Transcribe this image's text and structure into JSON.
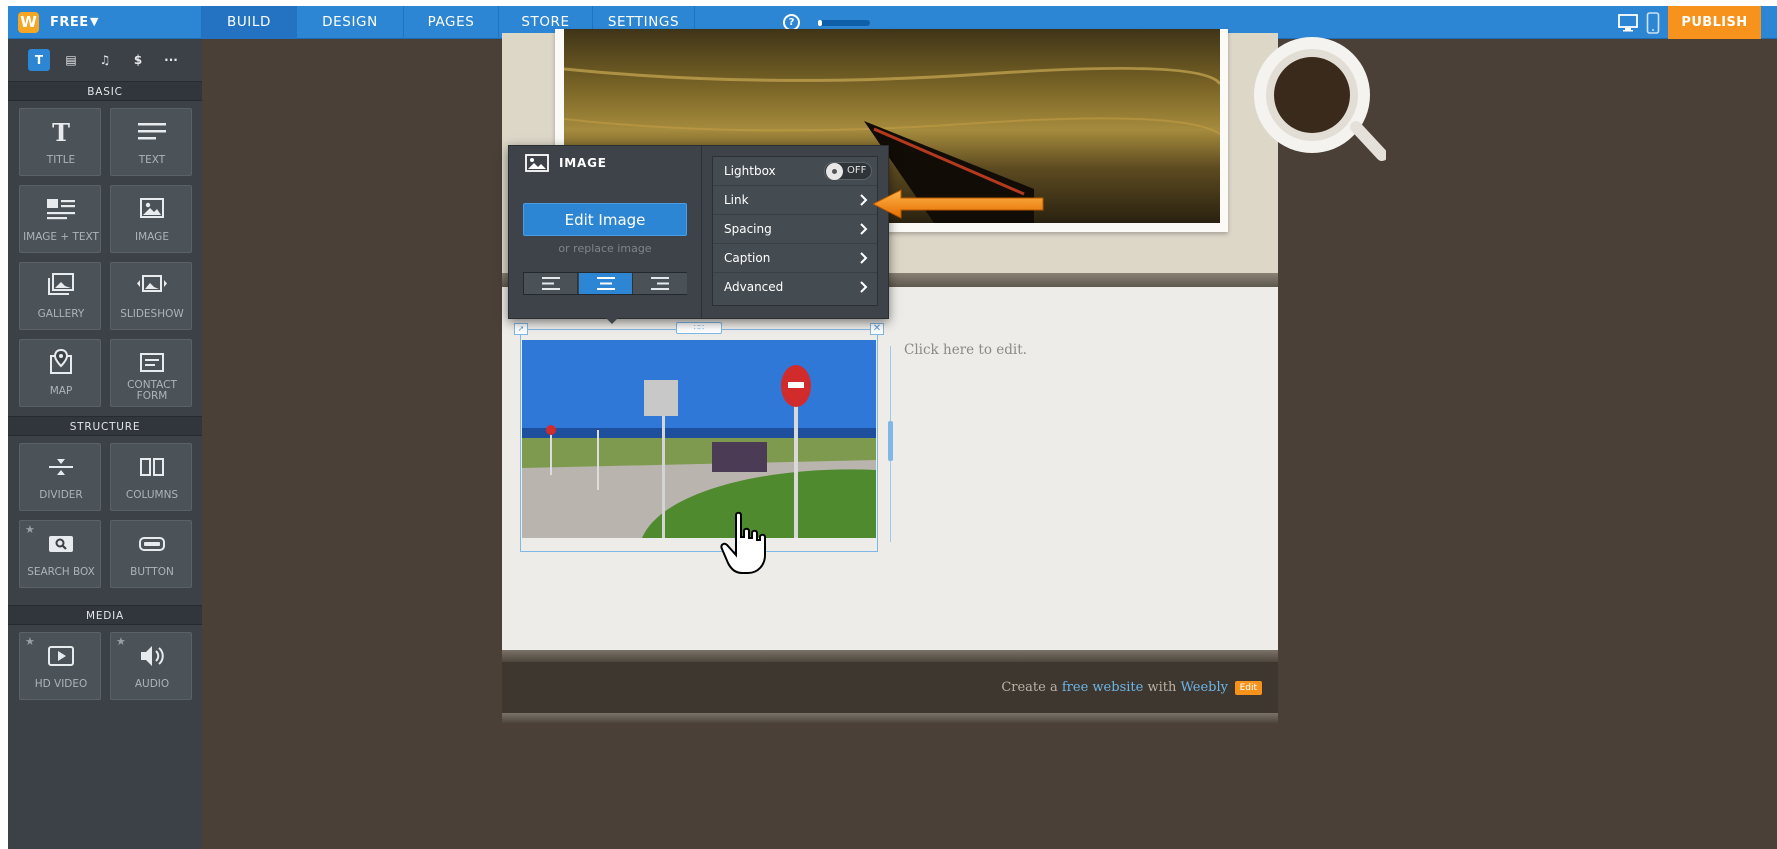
{
  "topbar": {
    "logo": "W",
    "plan": "FREE",
    "tabs": [
      {
        "label": "BUILD",
        "active": true
      },
      {
        "label": "DESIGN",
        "active": false
      },
      {
        "label": "PAGES",
        "active": false
      },
      {
        "label": "STORE",
        "active": false
      },
      {
        "label": "SETTINGS",
        "active": false
      }
    ],
    "help": "?",
    "progress_fraction": 0.05,
    "publish_label": "PUBLISH",
    "accent": "#2d86d4",
    "publish_color": "#f7931d"
  },
  "sidebar": {
    "categories": [
      {
        "icon": "text-t-icon",
        "glyph": "T",
        "active": true
      },
      {
        "icon": "layout-icon",
        "glyph": "▤",
        "active": false
      },
      {
        "icon": "music-note-icon",
        "glyph": "♫",
        "active": false
      },
      {
        "icon": "dollar-icon",
        "glyph": "$",
        "active": false
      },
      {
        "icon": "more-icon",
        "glyph": "···",
        "active": false
      }
    ],
    "sections": {
      "basic": "BASIC",
      "structure": "STRUCTURE",
      "media": "MEDIA"
    },
    "basic_items": [
      {
        "label": "TITLE",
        "icon": "title-icon"
      },
      {
        "label": "TEXT",
        "icon": "text-icon"
      },
      {
        "label": "IMAGE + TEXT",
        "icon": "image-text-icon"
      },
      {
        "label": "IMAGE",
        "icon": "image-icon"
      },
      {
        "label": "GALLERY",
        "icon": "gallery-icon"
      },
      {
        "label": "SLIDESHOW",
        "icon": "slideshow-icon"
      },
      {
        "label": "MAP",
        "icon": "map-pin-icon"
      },
      {
        "label": "CONTACT FORM",
        "icon": "contact-form-icon"
      }
    ],
    "structure_items": [
      {
        "label": "DIVIDER",
        "icon": "divider-icon"
      },
      {
        "label": "COLUMNS",
        "icon": "columns-icon"
      },
      {
        "label": "SEARCH BOX",
        "icon": "search-box-icon",
        "starred": true
      },
      {
        "label": "BUTTON",
        "icon": "button-icon"
      }
    ],
    "media_items": [
      {
        "label": "HD VIDEO",
        "icon": "video-icon",
        "starred": true
      },
      {
        "label": "AUDIO",
        "icon": "audio-icon",
        "starred": true
      }
    ]
  },
  "popup": {
    "title": "IMAGE",
    "edit_label": "Edit Image",
    "replace_label": "or replace image",
    "alignment": "center",
    "options": [
      {
        "label": "Lightbox",
        "type": "toggle",
        "value": "OFF"
      },
      {
        "label": "Link",
        "type": "submenu"
      },
      {
        "label": "Spacing",
        "type": "submenu"
      },
      {
        "label": "Caption",
        "type": "submenu"
      },
      {
        "label": "Advanced",
        "type": "submenu"
      }
    ]
  },
  "page": {
    "placeholder_text": "Click here to edit.",
    "footer": {
      "prefix": "Create a",
      "link1": "free website",
      "middle": "with",
      "link2": "Weebly",
      "edit_badge": "Edit"
    }
  }
}
